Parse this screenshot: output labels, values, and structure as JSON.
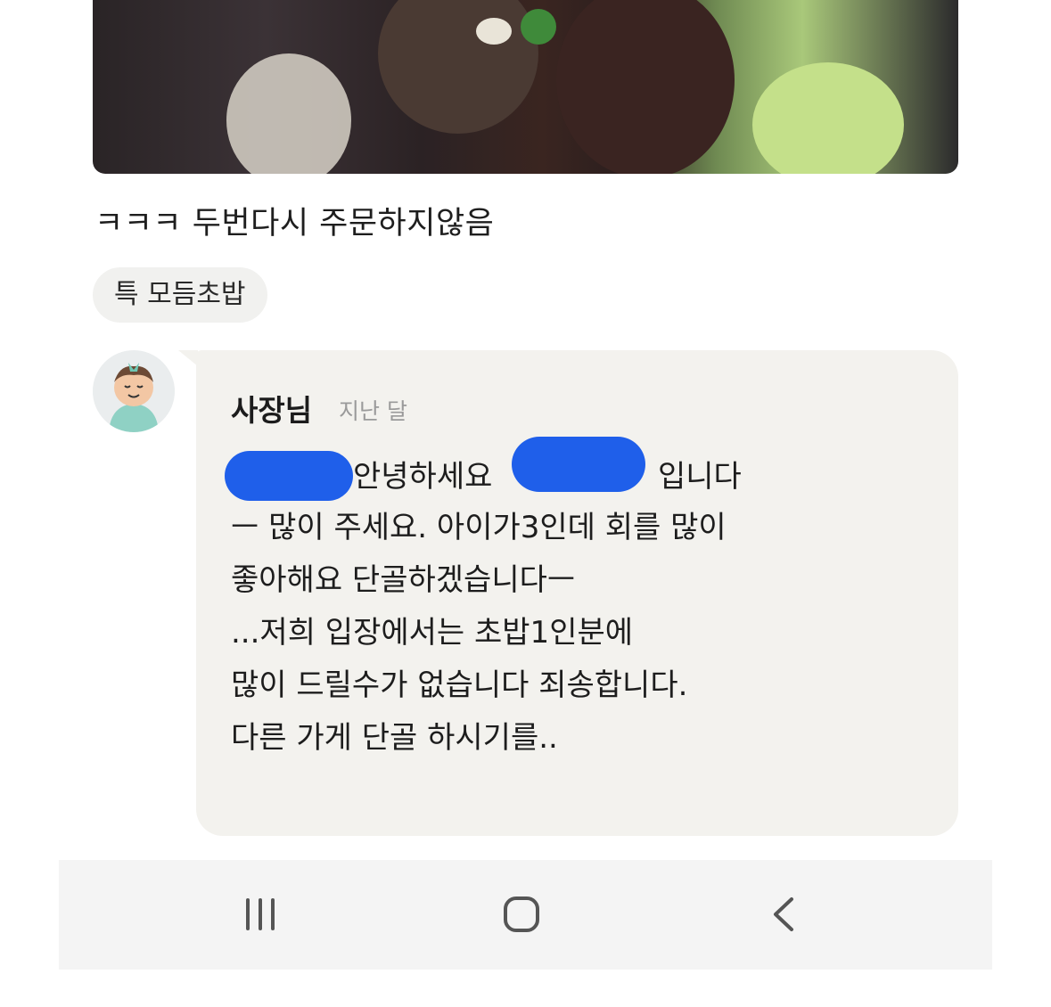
{
  "review": {
    "text": "ㅋㅋㅋ  두번다시 주문하지않음",
    "menu_chip": "특 모듬초밥"
  },
  "reply": {
    "owner_name": "사장님",
    "time": "지난 달",
    "lines": [
      "안녕하세요",
      "입니다",
      "ㅡ 많이 주세요. 아이가3인데 회를 많이",
      "좋아해요 단골하겠습니다ㅡ",
      "...저희 입장에서는 초밥1인분에",
      "많이 드릴수가 없습니다 죄송합니다.",
      "다른 가게 단골 하시기를.."
    ]
  },
  "navbar": {
    "recent_icon": "recent-apps-icon",
    "home_icon": "home-icon",
    "back_icon": "back-icon"
  },
  "colors": {
    "bubble": "#f3f2ee",
    "redaction": "#1f5fea",
    "navbar": "#f4f4f4"
  }
}
